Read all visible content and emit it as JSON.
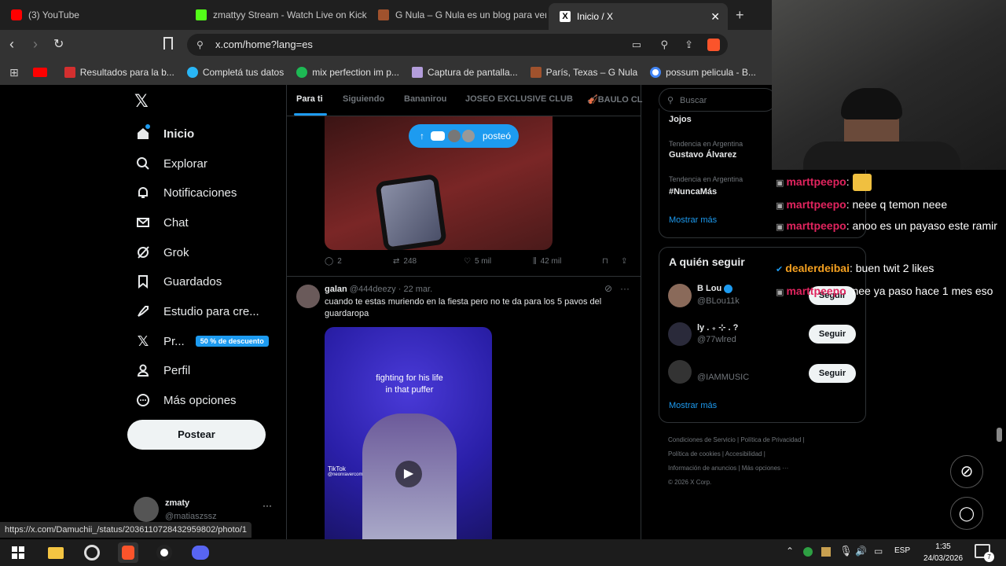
{
  "browser": {
    "tabs": [
      {
        "title": "(3) YouTube",
        "icon": "youtube-icon",
        "color": "#ff0000"
      },
      {
        "title": "zmattyy Stream - Watch Live on Kick",
        "icon": "kick-icon",
        "color": "#53fc18"
      },
      {
        "title": "G Nula – G Nula es un blog para ver",
        "icon": "gnula-icon",
        "color": "#a0522d"
      },
      {
        "title": "Inicio / X",
        "icon": "x-icon",
        "color": "#ffffff"
      }
    ],
    "url": "x.com/home?lang=es",
    "bookmarks": [
      {
        "label": "Resultados para la b...",
        "icon": "bookmark-favicon",
        "color": "#d32f2f"
      },
      {
        "label": "Completá tus datos",
        "icon": "circle-favicon",
        "color": "#29b6f6"
      },
      {
        "label": "mix perfection im p...",
        "icon": "spotify-icon",
        "color": "#1db954"
      },
      {
        "label": "Captura de pantalla...",
        "icon": "feather-icon",
        "color": "#b39ddb"
      },
      {
        "label": "París, Texas – G Nula",
        "icon": "gnula-icon",
        "color": "#a0522d"
      },
      {
        "label": "possum pelicula - B...",
        "icon": "google-icon",
        "color": "#4285f4"
      }
    ]
  },
  "sidebar": {
    "items": [
      {
        "label": "Inicio",
        "icon": "home-icon"
      },
      {
        "label": "Explorar",
        "icon": "search-icon"
      },
      {
        "label": "Notificaciones",
        "icon": "bell-icon"
      },
      {
        "label": "Chat",
        "icon": "mail-icon"
      },
      {
        "label": "Grok",
        "icon": "grok-icon"
      },
      {
        "label": "Guardados",
        "icon": "bookmark-icon"
      },
      {
        "label": "Estudio para cre...",
        "icon": "rocket-icon"
      },
      {
        "label": "Pr...",
        "icon": "x-premium-icon"
      },
      {
        "label": "Perfil",
        "icon": "person-icon"
      },
      {
        "label": "Más opciones",
        "icon": "more-circle-icon"
      }
    ],
    "premium_badge": "50 % de descuento",
    "post_button": "Postear",
    "account": {
      "name": "zmaty",
      "handle": "@matiaszssz"
    }
  },
  "feed": {
    "tabs": [
      "Para ti",
      "Siguiendo",
      "Bananirou",
      "JOSEO EXCLUSIVE CLUB",
      "🎻BAULO CL"
    ],
    "posted_pill": "posteó",
    "metrics1": {
      "replies": "2",
      "reposts": "248",
      "likes": "5 mil",
      "views": "42 mil"
    },
    "post2": {
      "name": "galan",
      "handle": "@444deezy",
      "date": "· 22 mar.",
      "text": "cuando te estas muriendo en la fiesta pero no te da para los 5 pavos del guardaropa",
      "video_caption": "fighting for his life in that puffer",
      "tiktok_label": "TikTok",
      "tiktok_handle": "@neonravercom"
    }
  },
  "right": {
    "search_placeholder": "Buscar",
    "trends": [
      {
        "meta": "",
        "name": "Jojos"
      },
      {
        "meta": "Tendencia en Argentina",
        "name": "Gustavo Álvarez"
      },
      {
        "meta": "Tendencia en Argentina",
        "name": "#NuncaMás"
      }
    ],
    "show_more": "Mostrar más",
    "who_to_follow_title": "A quién seguir",
    "suggestions": [
      {
        "name": "B Lou",
        "handle": "@BLou11k",
        "follow": "Seguir"
      },
      {
        "name": "ly . ₊ ⊹ . ?",
        "handle": "@77wlred",
        "follow": "Seguir"
      },
      {
        "name": "",
        "handle": "@IAMMUSIC",
        "follow": "Seguir"
      }
    ],
    "show_more2": "Mostrar más",
    "footer": [
      "Condiciones de Servicio  |  Política de Privacidad  |",
      "Política de cookies  |  Accesibilidad  |",
      "Información de anuncios  |  Más opciones ···",
      "© 2026 X Corp."
    ]
  },
  "stream_chat": [
    {
      "user": "marttpeepo",
      "text": ":"
    },
    {
      "user": "marttpeepo",
      "text": ": neee q temon neee"
    },
    {
      "user": "marttpeepo",
      "text": ": anoo es un payaso este ramir"
    },
    {
      "user": "dealerdeibai",
      "text": ": buen twit 2 likes"
    },
    {
      "user": "marttpeepo",
      "text": ": nee ya paso hace 1 mes eso"
    }
  ],
  "status_url": "https://x.com/Damuchii_/status/2036110728432959802/photo/1",
  "taskbar": {
    "lang": "ESP",
    "time": "1:35",
    "date": "24/03/2026",
    "notif_count": "7"
  }
}
